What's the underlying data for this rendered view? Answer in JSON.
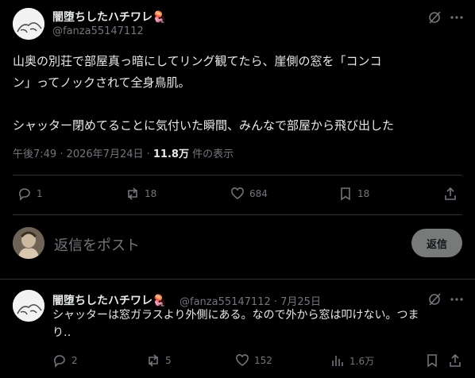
{
  "main_tweet": {
    "display_name": "闇堕ちしたハチワレ🪼",
    "handle": "@fanza55147112",
    "text_line1": "山奥の別荘で部屋真っ暗にしてリング観てたら、崖側の窓を「コンコ",
    "text_line2": "ン」ってノックされて全身鳥肌。",
    "text_line3": "シャッター閉めてることに気付いた瞬間、みんなで部屋から飛び出した",
    "time": "午後7:49 · 2026年7月24日 · ",
    "views_count": "11.8万",
    "views_label": " 件の表示",
    "actions": {
      "replies": "1",
      "retweets": "18",
      "likes": "684",
      "bookmarks": "18"
    }
  },
  "composer": {
    "placeholder": "返信をポスト",
    "button": "返信"
  },
  "reply_tweet": {
    "display_name": "闇堕ちしたハチワレ🪼",
    "handle": "@fanza55147112 · 7月25日",
    "text_line1": "シャッターは窓ガラスより外側にある。なので外から窓は叩けない。つま",
    "text_line2": "り‥",
    "actions": {
      "replies": "2",
      "retweets": "5",
      "likes": "152",
      "views": "1.6万"
    }
  },
  "icons": [
    "grok-icon",
    "more-icon",
    "reply-icon",
    "retweet-icon",
    "like-icon",
    "bookmark-icon",
    "share-icon",
    "views-icon"
  ]
}
